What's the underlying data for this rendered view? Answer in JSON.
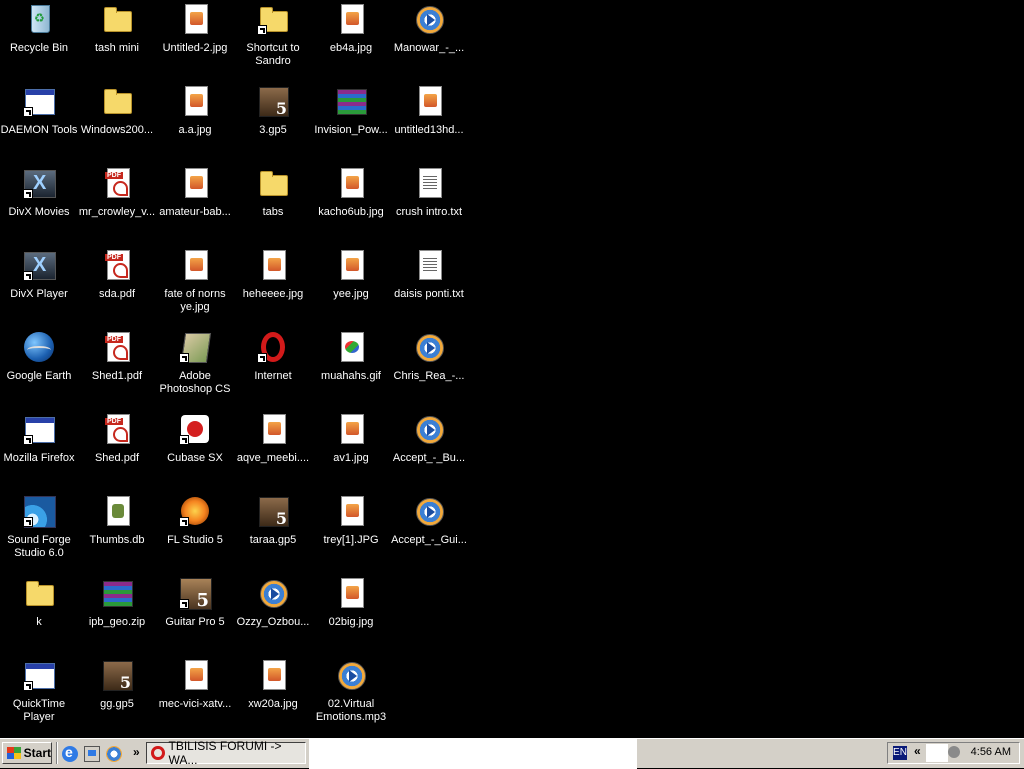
{
  "desktop": {
    "columns": [
      [
        {
          "label": "Recycle Bin",
          "type": "bin",
          "shortcut": false
        },
        {
          "label": "DAEMON Tools",
          "type": "app",
          "shortcut": true
        },
        {
          "label": "DivX Movies",
          "type": "divx",
          "shortcut": true
        },
        {
          "label": "DivX Player",
          "type": "divx",
          "shortcut": true
        },
        {
          "label": "Google Earth",
          "type": "earth",
          "shortcut": false
        },
        {
          "label": "Mozilla Firefox",
          "type": "app",
          "shortcut": true
        },
        {
          "label": "Sound Forge Studio 6.0",
          "type": "sf",
          "shortcut": true
        },
        {
          "label": "k",
          "type": "folder",
          "shortcut": false
        },
        {
          "label": "QuickTime Player",
          "type": "app",
          "shortcut": true
        }
      ],
      [
        {
          "label": "tash mini",
          "type": "folder",
          "shortcut": false
        },
        {
          "label": "Windows200...",
          "type": "folder",
          "shortcut": false
        },
        {
          "label": "mr_crowley_v...",
          "type": "pdf",
          "shortcut": false
        },
        {
          "label": "sda.pdf",
          "type": "pdf",
          "shortcut": false
        },
        {
          "label": "Shed1.pdf",
          "type": "pdf",
          "shortcut": false
        },
        {
          "label": "Shed.pdf",
          "type": "pdf",
          "shortcut": false
        },
        {
          "label": "Thumbs.db",
          "type": "db",
          "shortcut": false
        },
        {
          "label": "ipb_geo.zip",
          "type": "rar",
          "shortcut": false
        },
        {
          "label": "gg.gp5",
          "type": "gp5",
          "shortcut": false
        }
      ],
      [
        {
          "label": "Untitled-2.jpg",
          "type": "img",
          "shortcut": false
        },
        {
          "label": "a.a.jpg",
          "type": "img",
          "shortcut": false
        },
        {
          "label": "amateur-bab...",
          "type": "img",
          "shortcut": false
        },
        {
          "label": "fate of norns ye.jpg",
          "type": "img",
          "shortcut": false
        },
        {
          "label": "Adobe Photoshop CS",
          "type": "ps",
          "shortcut": true
        },
        {
          "label": "Cubase SX",
          "type": "cubase",
          "shortcut": true
        },
        {
          "label": "FL Studio 5",
          "type": "fl",
          "shortcut": true
        },
        {
          "label": "Guitar Pro 5",
          "type": "gp",
          "shortcut": true
        },
        {
          "label": "mec-vici-xatv...",
          "type": "img",
          "shortcut": false
        }
      ],
      [
        {
          "label": "Shortcut to Sandro",
          "type": "folder",
          "shortcut": true
        },
        {
          "label": "3.gp5",
          "type": "gp5",
          "shortcut": false
        },
        {
          "label": "tabs",
          "type": "folder",
          "shortcut": false
        },
        {
          "label": "heheeee.jpg",
          "type": "img",
          "shortcut": false
        },
        {
          "label": "Internet",
          "type": "opera",
          "shortcut": true
        },
        {
          "label": "aqve_meebi....",
          "type": "img",
          "shortcut": false
        },
        {
          "label": "taraa.gp5",
          "type": "gp5",
          "shortcut": false
        },
        {
          "label": "Ozzy_Ozbou...",
          "type": "media",
          "shortcut": false
        },
        {
          "label": "xw20a.jpg",
          "type": "img",
          "shortcut": false
        }
      ],
      [
        {
          "label": "eb4a.jpg",
          "type": "img",
          "shortcut": false
        },
        {
          "label": "Invision_Pow...",
          "type": "rar",
          "shortcut": false
        },
        {
          "label": "kacho6ub.jpg",
          "type": "img",
          "shortcut": false
        },
        {
          "label": "yee.jpg",
          "type": "img",
          "shortcut": false
        },
        {
          "label": "muahahs.gif",
          "type": "gif",
          "shortcut": false
        },
        {
          "label": "av1.jpg",
          "type": "img",
          "shortcut": false
        },
        {
          "label": "trey[1].JPG",
          "type": "img",
          "shortcut": false
        },
        {
          "label": "02big.jpg",
          "type": "img",
          "shortcut": false
        },
        {
          "label": "02.Virtual Emotions.mp3",
          "type": "media",
          "shortcut": false
        }
      ],
      [
        {
          "label": "Manowar_-_...",
          "type": "media",
          "shortcut": false
        },
        {
          "label": "untitled13hd...",
          "type": "img",
          "shortcut": false
        },
        {
          "label": "crush intro.txt",
          "type": "txt",
          "shortcut": false
        },
        {
          "label": "daisis ponti.txt",
          "type": "txt",
          "shortcut": false
        },
        {
          "label": "Chris_Rea_-...",
          "type": "media",
          "shortcut": false
        },
        {
          "label": "Accept_-_Bu...",
          "type": "media",
          "shortcut": false
        },
        {
          "label": "Accept_-_Gui...",
          "type": "media",
          "shortcut": false
        }
      ]
    ]
  },
  "taskbar": {
    "start_label": "Start",
    "quick_launch": [
      "internet-explorer-icon",
      "show-desktop-icon",
      "media-player-icon"
    ],
    "more_glyph": "»",
    "task_button_label": "TBILISIS FORUMI -> WA...",
    "lang": "EN",
    "tray_arrow": "«",
    "clock": "4:56 AM"
  }
}
